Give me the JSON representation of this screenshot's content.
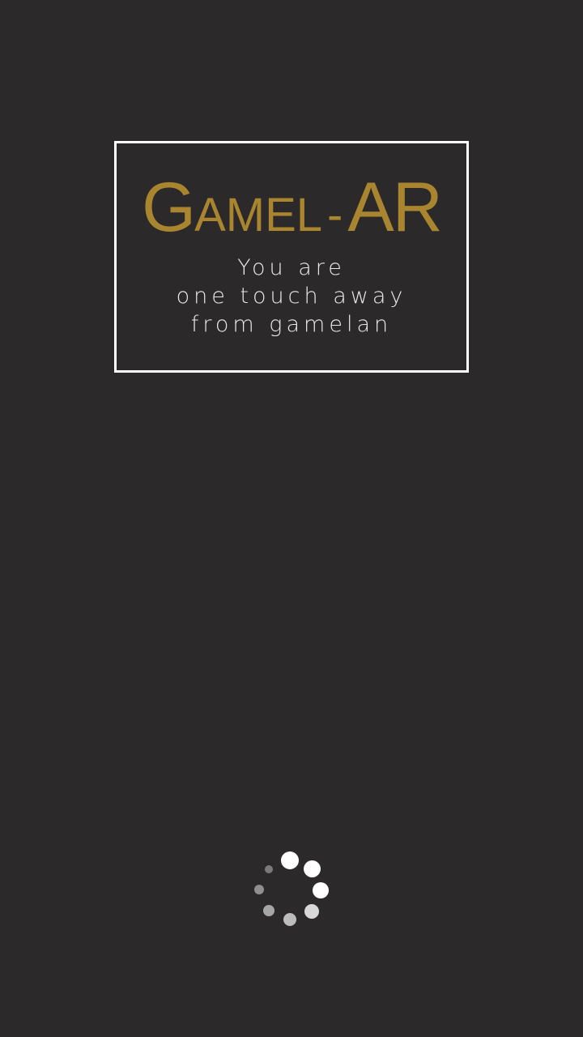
{
  "logo": {
    "g": "G",
    "amel": "AMEL",
    "dash": "-",
    "ar": "AR"
  },
  "tagline": {
    "line1": "You are",
    "line2": "one touch away",
    "line3": "from gamelan"
  },
  "colors": {
    "background": "#2b292a",
    "gold": "#a8852e",
    "frame": "#ffffff"
  },
  "loading_indicator": {
    "icon": "loading-spinner-icon"
  }
}
